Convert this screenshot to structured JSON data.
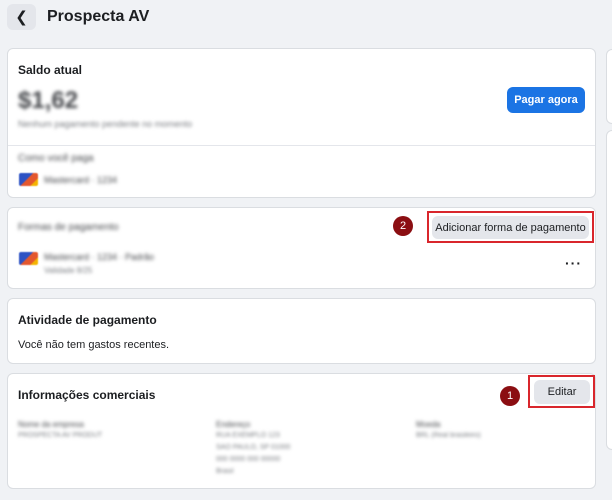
{
  "header": {
    "title": "Prospecta AV",
    "back_icon": "chevron-left-icon"
  },
  "balance_card": {
    "title": "Saldo atual",
    "amount": "$1,62",
    "amount_note": "Nenhum pagamento pendente no momento",
    "pay_button": "Pagar agora",
    "method_label": "Como você paga",
    "method_value": "Mastercard · 1234"
  },
  "methods_card": {
    "title": "Formas de pagamento",
    "add_button": "Adicionar forma de pagamento",
    "marker": "2",
    "card_line": "Mastercard · 1234 · Padrão",
    "card_sub": "Validade 8/25",
    "more_icon": "more-horizontal-icon"
  },
  "activity_card": {
    "title": "Atividade de pagamento",
    "empty_text": "Você não tem gastos recentes."
  },
  "business_card": {
    "title": "Informações comerciais",
    "edit_button": "Editar",
    "marker": "1",
    "columns": [
      {
        "label": "Nome da empresa",
        "lines": [
          "PROSPECTA AV PRODUT"
        ]
      },
      {
        "label": "Endereço",
        "lines": [
          "RUA EXEMPLO 123",
          "SAO PAULO, SP 01000",
          "000 0000 000 00000",
          "Brasil"
        ]
      },
      {
        "label": "Moeda",
        "lines": [
          "BRL (Real brasileiro)"
        ]
      }
    ]
  },
  "colors": {
    "primary": "#1b74e4",
    "annotation": "#d9262c",
    "marker": "#8b0e12",
    "background": "#f0f2f5"
  }
}
